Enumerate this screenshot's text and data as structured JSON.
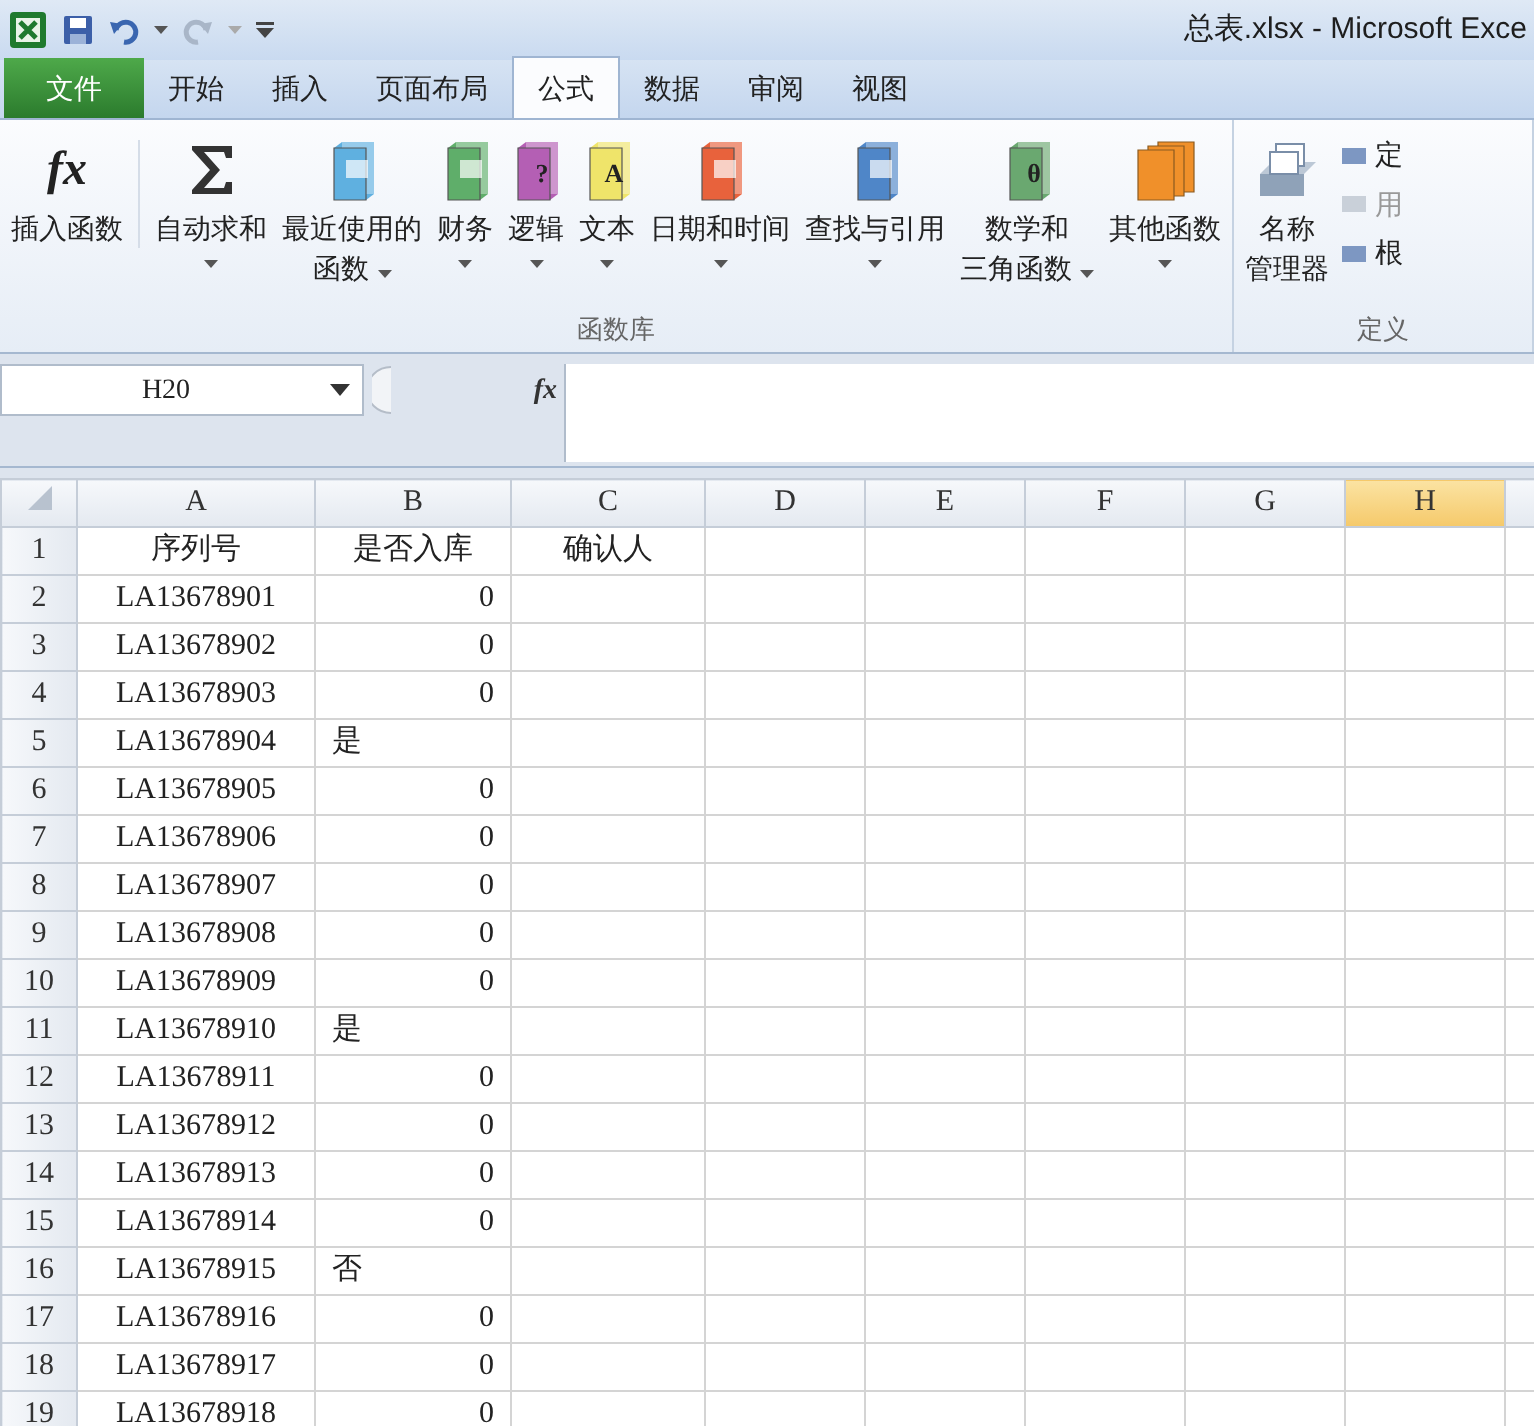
{
  "title_bar": {
    "title": "总表.xlsx - Microsoft Exce"
  },
  "tabs": [
    {
      "label": "文件",
      "kind": "file",
      "selected": false
    },
    {
      "label": "开始",
      "kind": "tab",
      "selected": false
    },
    {
      "label": "插入",
      "kind": "tab",
      "selected": false
    },
    {
      "label": "页面布局",
      "kind": "tab",
      "selected": false
    },
    {
      "label": "公式",
      "kind": "tab",
      "selected": true
    },
    {
      "label": "数据",
      "kind": "tab",
      "selected": false
    },
    {
      "label": "审阅",
      "kind": "tab",
      "selected": false
    },
    {
      "label": "视图",
      "kind": "tab",
      "selected": false
    }
  ],
  "ribbon": {
    "groups": [
      {
        "label": "函数库",
        "buttons": [
          {
            "lines": [
              "插入函数"
            ],
            "kind": "fx",
            "glyph": "fx",
            "dropdown": false
          },
          {
            "lines": [
              "自动求和"
            ],
            "kind": "sigma",
            "dropdown": true
          },
          {
            "lines": [
              "最近使用的",
              "函数"
            ],
            "kind": "book",
            "color": "#5fb0e0",
            "dropdown": true
          },
          {
            "lines": [
              "财务"
            ],
            "kind": "book",
            "color": "#5fae6a",
            "dropdown": true
          },
          {
            "lines": [
              "逻辑"
            ],
            "kind": "book",
            "color": "#b45fb4",
            "glyph": "?",
            "dropdown": true
          },
          {
            "lines": [
              "文本"
            ],
            "kind": "book",
            "color": "#efe46a",
            "glyph": "A",
            "dropdown": true
          },
          {
            "lines": [
              "日期和时间"
            ],
            "kind": "book",
            "color": "#e8623c",
            "dropdown": true
          },
          {
            "lines": [
              "查找与引用"
            ],
            "kind": "book",
            "color": "#4f86c8",
            "dropdown": true
          },
          {
            "lines": [
              "数学和",
              "三角函数"
            ],
            "kind": "book",
            "color": "#6aa870",
            "glyph": "θ",
            "dropdown": true
          },
          {
            "lines": [
              "其他函数"
            ],
            "kind": "books",
            "color": "#f0902a",
            "dropdown": true
          }
        ]
      },
      {
        "label": "定义",
        "buttons": [
          {
            "lines": [
              "名称",
              "管理器"
            ],
            "kind": "names",
            "dropdown": false
          }
        ],
        "small_items": [
          "定",
          "用",
          "根"
        ]
      }
    ]
  },
  "formula_bar": {
    "name_box": "H20",
    "fx_label": "fx"
  },
  "sheet": {
    "columns": [
      {
        "label": "A",
        "selected": false
      },
      {
        "label": "B",
        "selected": false
      },
      {
        "label": "C",
        "selected": false
      },
      {
        "label": "D",
        "selected": false
      },
      {
        "label": "E",
        "selected": false
      },
      {
        "label": "F",
        "selected": false
      },
      {
        "label": "G",
        "selected": false
      },
      {
        "label": "H",
        "selected": true
      }
    ],
    "rows": [
      {
        "number": "1",
        "cells": [
          {
            "text": "序列号",
            "kind": "center"
          },
          {
            "text": "是否入库",
            "kind": "center"
          },
          {
            "text": "确认人",
            "kind": "center"
          }
        ]
      },
      {
        "number": "2",
        "cells": [
          {
            "text": "LA13678901",
            "kind": "center"
          },
          {
            "text": "0",
            "kind": "number"
          }
        ]
      },
      {
        "number": "3",
        "cells": [
          {
            "text": "LA13678902",
            "kind": "center"
          },
          {
            "text": "0",
            "kind": "number"
          }
        ]
      },
      {
        "number": "4",
        "cells": [
          {
            "text": "LA13678903",
            "kind": "center"
          },
          {
            "text": "0",
            "kind": "number"
          }
        ]
      },
      {
        "number": "5",
        "cells": [
          {
            "text": "LA13678904",
            "kind": "center"
          },
          {
            "text": "是",
            "kind": "text"
          }
        ]
      },
      {
        "number": "6",
        "cells": [
          {
            "text": "LA13678905",
            "kind": "center"
          },
          {
            "text": "0",
            "kind": "number"
          }
        ]
      },
      {
        "number": "7",
        "cells": [
          {
            "text": "LA13678906",
            "kind": "center"
          },
          {
            "text": "0",
            "kind": "number"
          }
        ]
      },
      {
        "number": "8",
        "cells": [
          {
            "text": "LA13678907",
            "kind": "center"
          },
          {
            "text": "0",
            "kind": "number"
          }
        ]
      },
      {
        "number": "9",
        "cells": [
          {
            "text": "LA13678908",
            "kind": "center"
          },
          {
            "text": "0",
            "kind": "number"
          }
        ]
      },
      {
        "number": "10",
        "cells": [
          {
            "text": "LA13678909",
            "kind": "center"
          },
          {
            "text": "0",
            "kind": "number"
          }
        ]
      },
      {
        "number": "11",
        "cells": [
          {
            "text": "LA13678910",
            "kind": "center"
          },
          {
            "text": "是",
            "kind": "text"
          }
        ]
      },
      {
        "number": "12",
        "cells": [
          {
            "text": "LA13678911",
            "kind": "center"
          },
          {
            "text": "0",
            "kind": "number"
          }
        ]
      },
      {
        "number": "13",
        "cells": [
          {
            "text": "LA13678912",
            "kind": "center"
          },
          {
            "text": "0",
            "kind": "number"
          }
        ]
      },
      {
        "number": "14",
        "cells": [
          {
            "text": "LA13678913",
            "kind": "center"
          },
          {
            "text": "0",
            "kind": "number"
          }
        ]
      },
      {
        "number": "15",
        "cells": [
          {
            "text": "LA13678914",
            "kind": "center"
          },
          {
            "text": "0",
            "kind": "number"
          }
        ]
      },
      {
        "number": "16",
        "cells": [
          {
            "text": "LA13678915",
            "kind": "center"
          },
          {
            "text": "否",
            "kind": "text"
          }
        ]
      },
      {
        "number": "17",
        "cells": [
          {
            "text": "LA13678916",
            "kind": "center"
          },
          {
            "text": "0",
            "kind": "number"
          }
        ]
      },
      {
        "number": "18",
        "cells": [
          {
            "text": "LA13678917",
            "kind": "center"
          },
          {
            "text": "0",
            "kind": "number"
          }
        ]
      },
      {
        "number": "19",
        "cells": [
          {
            "text": "LA13678918",
            "kind": "center"
          },
          {
            "text": "0",
            "kind": "number"
          }
        ]
      }
    ]
  }
}
